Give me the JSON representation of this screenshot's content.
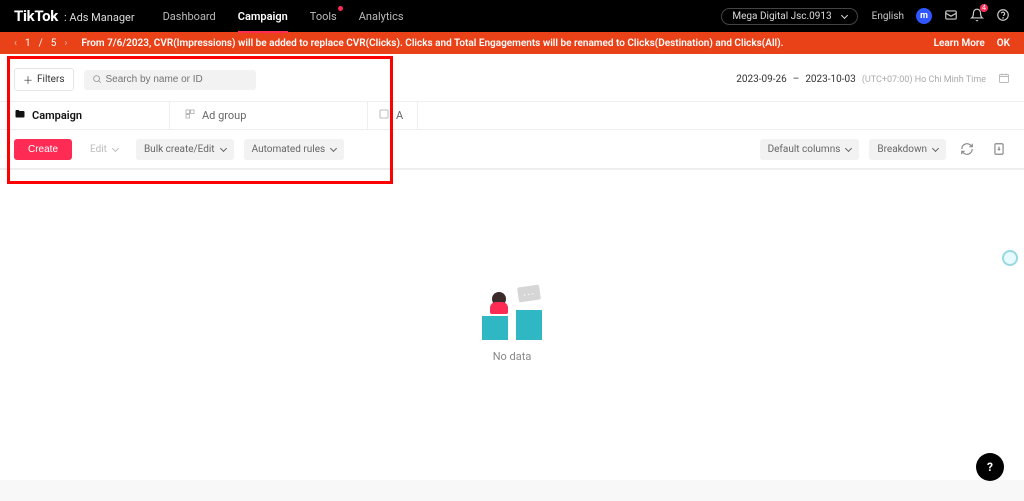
{
  "header": {
    "brand": "TikTok",
    "brand_suffix": ": Ads Manager",
    "nav": [
      "Dashboard",
      "Campaign",
      "Tools",
      "Analytics"
    ],
    "nav_active_index": 1,
    "nav_dot_index": 2,
    "account": "Mega Digital Jsc.0913",
    "language": "English",
    "avatar_letter": "m",
    "bell_count": "4"
  },
  "banner": {
    "pager_current": "1",
    "pager_sep": "/",
    "pager_total": "5",
    "message": "From 7/6/2023, CVR(Impressions) will be added to replace CVR(Clicks). Clicks and Total Engagements will be renamed to Clicks(Destination) and Clicks(All).",
    "learn_more": "Learn More",
    "ok": "OK"
  },
  "filters_row": {
    "filters_label": "Filters",
    "search_placeholder": "Search by name or ID",
    "date_from": "2023-09-26",
    "date_sep": "–",
    "date_to": "2023-10-03",
    "timezone": "(UTC+07:00) Ho Chi Minh Time"
  },
  "tabs": {
    "campaign": "Campaign",
    "adgroup": "Ad group",
    "ad": "A"
  },
  "toolbar": {
    "create": "Create",
    "edit": "Edit",
    "bulk": "Bulk create/Edit",
    "automated": "Automated rules",
    "default_cols": "Default columns",
    "breakdown": "Breakdown"
  },
  "empty": {
    "no_data": "No data"
  },
  "fab": {
    "label": "?"
  }
}
